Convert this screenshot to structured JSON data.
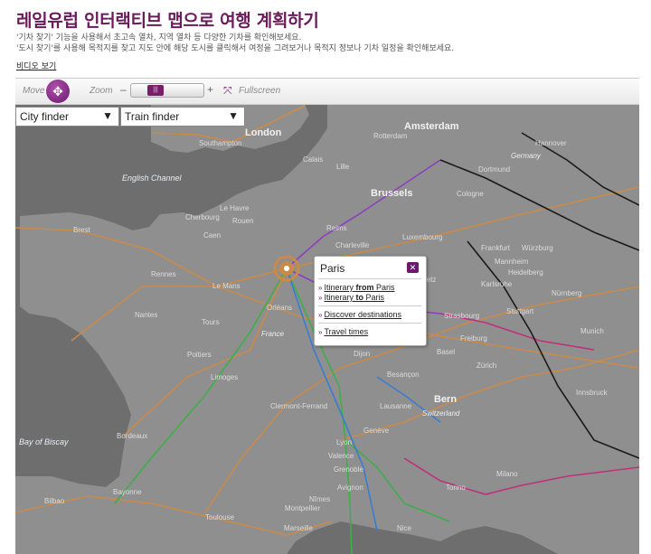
{
  "page": {
    "title": "레일유럽 인터랙티브 맵으로 여행 계획하기",
    "desc_line1": "'기차 찾기' 기능을 사용해서 초고속 열차, 지역 열차 등 다양한 기차를 확인해보세요.",
    "desc_line2": "'도시 찾기'를 사용해 목적지를 찾고 지도 안에 해당 도시를 클릭해서 여정을 그려보거나 목적지 정보나 기차 일정을 확인해보세요.",
    "video_link": "비디오 보기"
  },
  "toolbar": {
    "move_label": "Move",
    "zoom_label": "Zoom",
    "zoom_out": "–",
    "zoom_in": "+",
    "fullscreen_label": "Fullscreen",
    "move_icon": "four-way-arrows-icon",
    "fullscreen_icon": "fullscreen-arrows-icon"
  },
  "finders": {
    "city": "City finder",
    "train": "Train finder"
  },
  "popup": {
    "city": "Paris",
    "close": "✕",
    "itin_from_prefix": "Itinerary ",
    "itin_from_bold": "from",
    "itin_from_suffix": " Paris",
    "itin_to_prefix": "Itinerary ",
    "itin_to_bold": "to",
    "itin_to_suffix": " Paris",
    "discover": "Discover destinations",
    "travel": "Travel times"
  },
  "map": {
    "colors": {
      "land": "#8f8f8f",
      "sea": "#6e6e6e",
      "rail_orange": "#c98a4a",
      "rail_green": "#3fae4a",
      "rail_blue": "#3a7ccf",
      "rail_purple": "#8a3fbf",
      "rail_magenta": "#c0307a",
      "rail_black": "#1a1a1a",
      "accent": "#6a1a6a"
    },
    "labels": {
      "london": "London",
      "amsterdam": "Amsterdam",
      "brussels": "Brussels",
      "paris": "Paris",
      "bern": "Bern",
      "english_channel": "English Channel",
      "bay_of_biscay": "Bay of Biscay",
      "france": "France",
      "switzerland": "Switzerland",
      "germany": "Germany",
      "southampton": "Southampton",
      "rennes": "Rennes",
      "nantes": "Nantes",
      "le_mans": "Le Mans",
      "tours": "Tours",
      "orleans": "Orléans",
      "bordeaux": "Bordeaux",
      "lyon": "Lyon",
      "grenoble": "Grenoble",
      "marseille": "Marseille",
      "toulouse": "Toulouse",
      "strasbourg": "Strasbourg",
      "frankfurt": "Frankfurt",
      "stuttgart": "Stuttgart",
      "munich": "Munich",
      "nuremberg": "Nürnberg",
      "hannover": "Hannover",
      "cologne": "Cologne",
      "basel": "Basel",
      "lausanne": "Lausanne",
      "geneve": "Genève",
      "dijon": "Dijon",
      "caen": "Caen",
      "rouen": "Rouen",
      "reims": "Reims",
      "lille": "Lille",
      "calais": "Calais",
      "luxembourg": "Luxembourg",
      "limoges": "Limoges",
      "clermont": "Clermont-Ferrand",
      "nimes": "Nîmes",
      "montpellier": "Montpellier",
      "nice": "Nice",
      "milano": "Milano",
      "torino": "Torino",
      "bilbao": "Bilbao",
      "zurich": "Zürich",
      "mannheim": "Mannheim",
      "heidelberg": "Heidelberg",
      "karlsruhe": "Karlsruhe",
      "freiburg": "Freiburg",
      "metz": "Metz",
      "besancon": "Besançon",
      "poitiers": "Poitiers",
      "brest": "Brest",
      "avignon": "Avignon",
      "bayonne": "Bayonne",
      "dortmund": "Dortmund",
      "rotterdam": "Rotterdam",
      "wurzburg": "Würzburg",
      "innsbruck": "Innsbruck",
      "valence": "Valence",
      "charleville": "Charleville",
      "le_havre": "Le Havre",
      "cherbourg": "Cherbourg"
    }
  }
}
